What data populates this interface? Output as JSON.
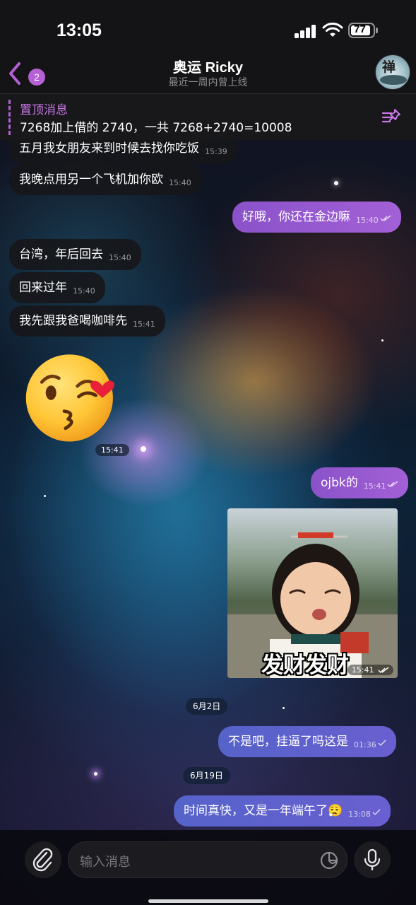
{
  "status": {
    "time": "13:05",
    "battery": "77"
  },
  "header": {
    "back_badge": "2",
    "title": "奥运 Ricky",
    "subtitle": "最近一周内曾上线",
    "avatar_glyph": "禅"
  },
  "pinned": {
    "title": "置顶消息",
    "text": "7268加上借的 2740，一共 7268+2740=10008"
  },
  "messages": [
    {
      "text": "五月我女朋友来到时候去找你吃饭",
      "time": "15:39"
    },
    {
      "text": "我晚点用另一个飞机加你欧",
      "time": "15:40"
    },
    {
      "text": "好哦，你还在金边嘛",
      "time": "15:40"
    },
    {
      "text": "台湾，年后回去",
      "time": "15:40"
    },
    {
      "text": "回来过年",
      "time": "15:40"
    },
    {
      "text": "我先跟我爸喝咖啡先",
      "time": "15:41"
    },
    {
      "text": "ojbk的",
      "time": "15:41"
    },
    {
      "text": "不是吧，挂逼了吗这是",
      "time": "01:36"
    },
    {
      "text": "时间真快，又是一年端午了😮‍💨",
      "time": "13:08"
    }
  ],
  "sticker": {
    "time": "15:41"
  },
  "photo": {
    "caption": "发财发财",
    "time": "15:41"
  },
  "dates": {
    "d1": "6月2日",
    "d2": "6月19日"
  },
  "input": {
    "placeholder": "输入消息"
  },
  "colors": {
    "accent": "#b560d4",
    "outgoing": "#9a5ad2",
    "incoming": "#16161a"
  }
}
